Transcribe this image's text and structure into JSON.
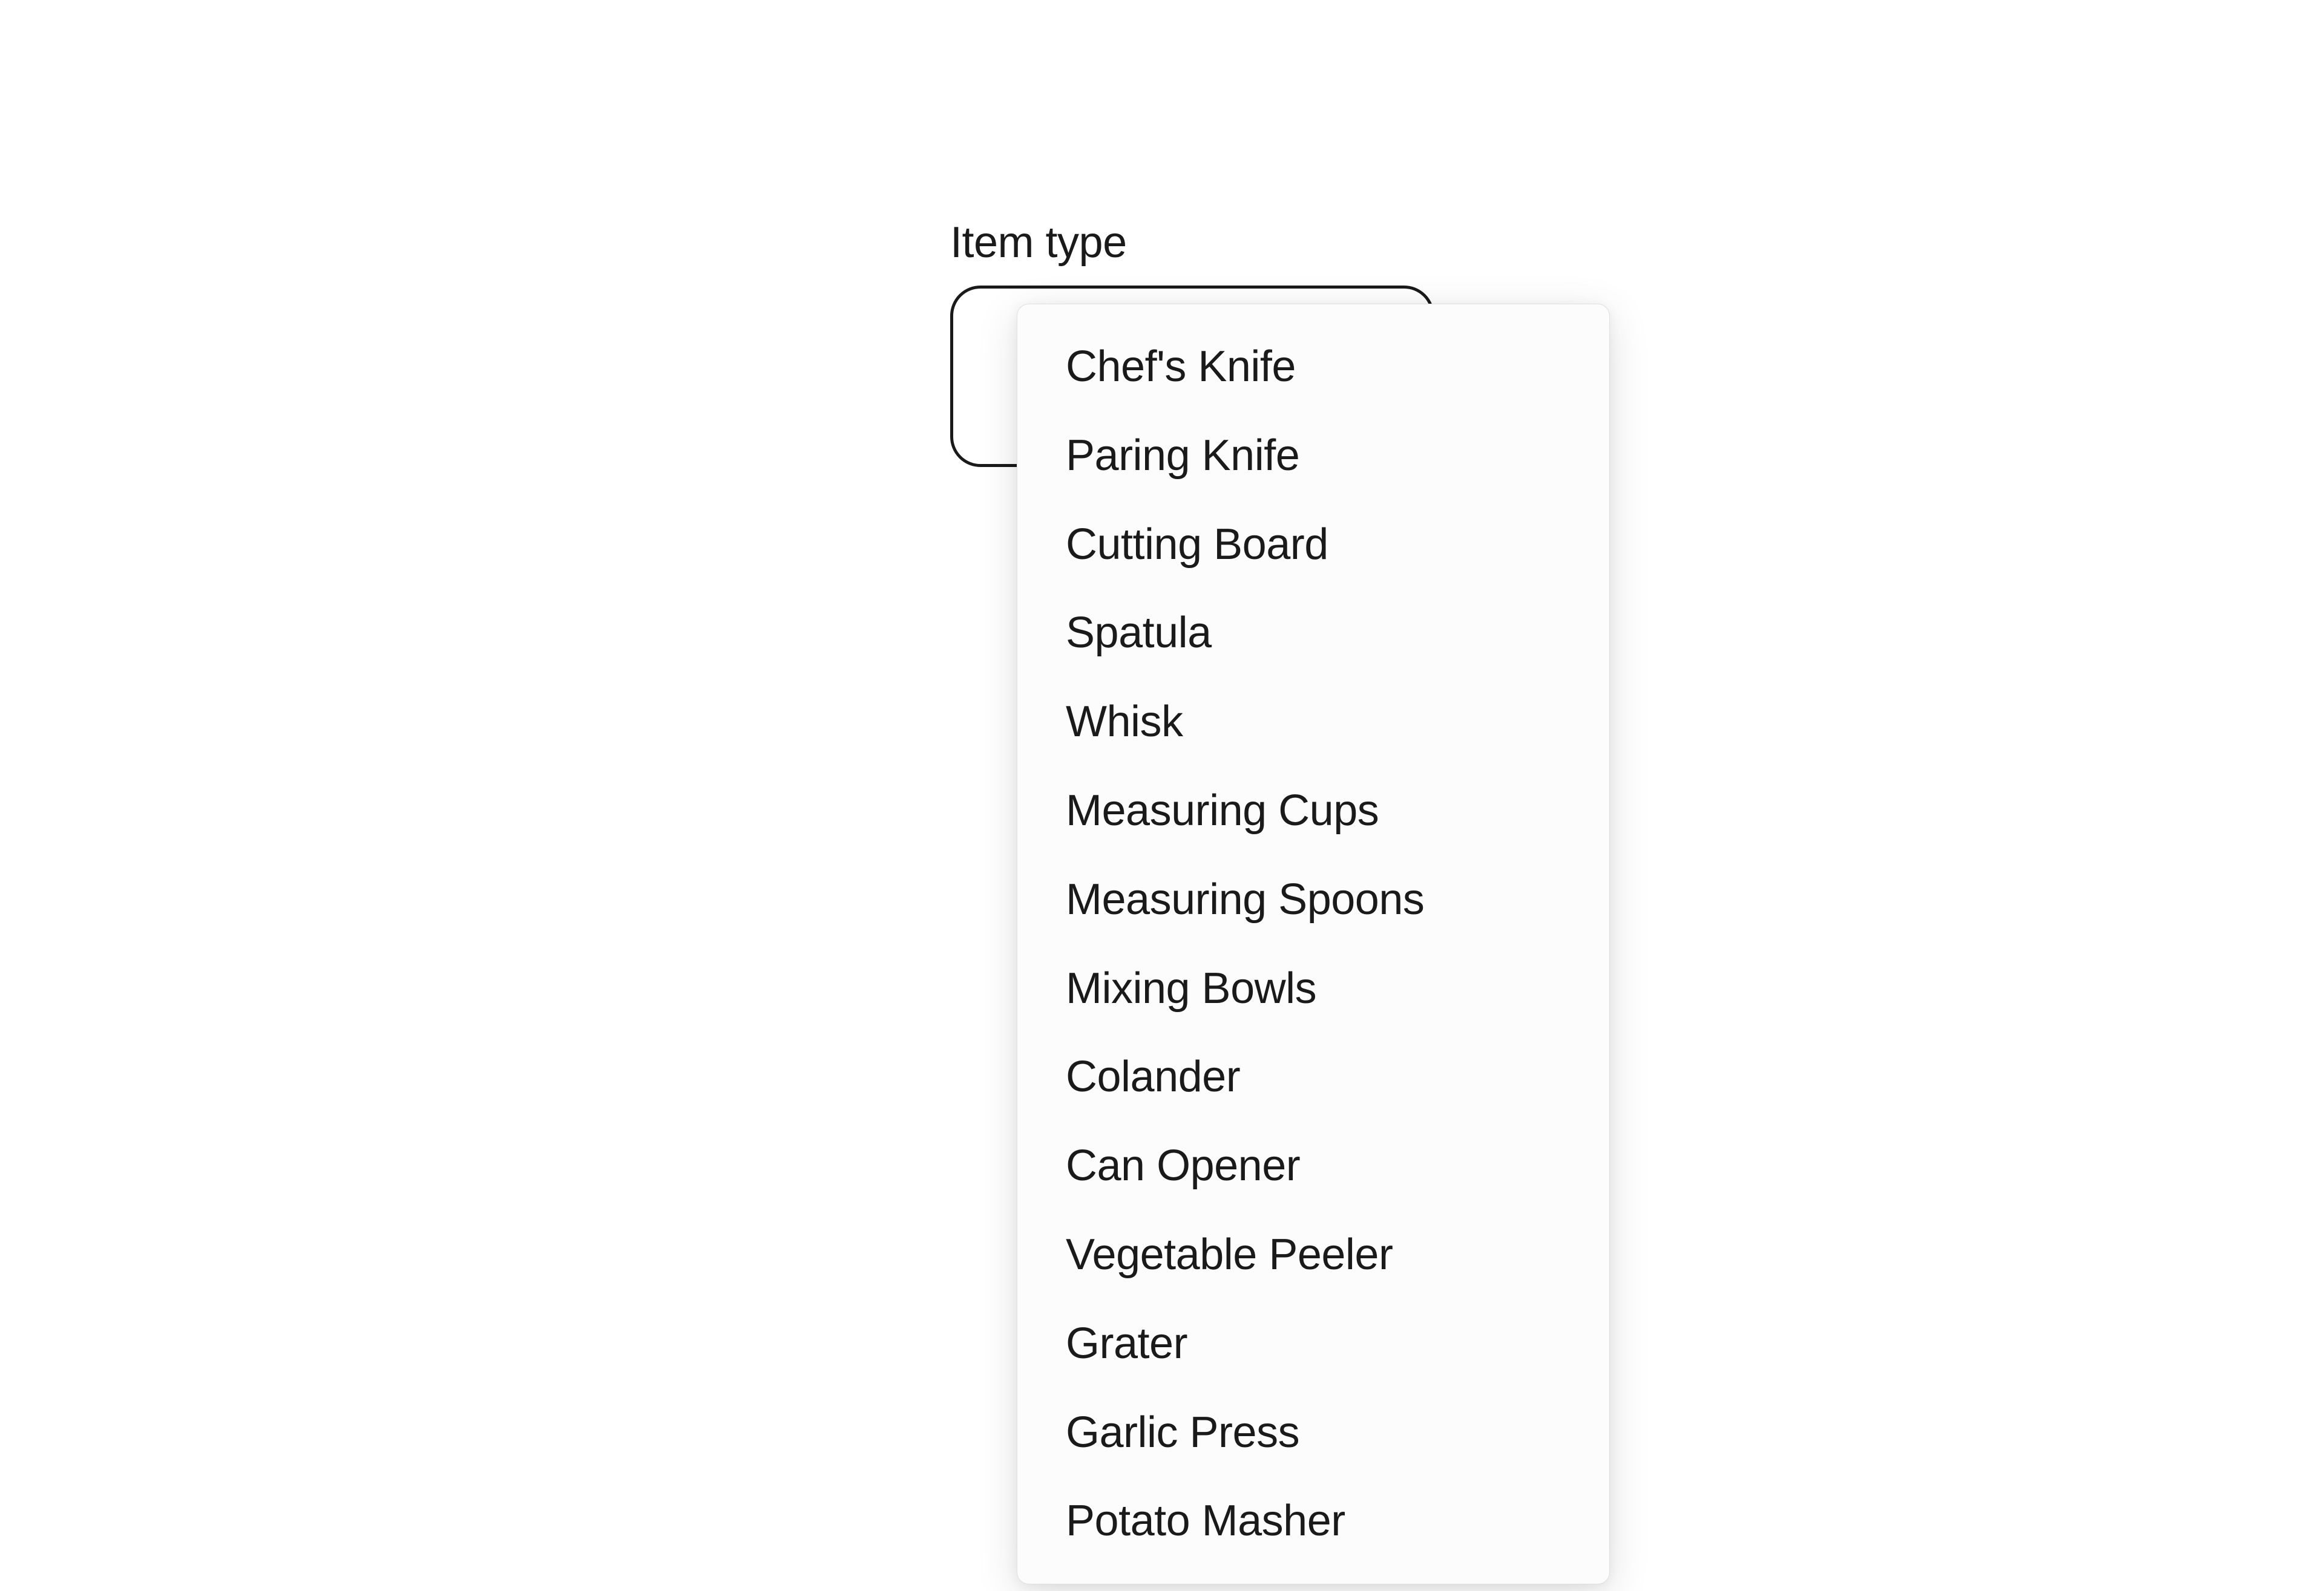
{
  "field": {
    "label": "Item type"
  },
  "dropdown": {
    "options": [
      "Chef's Knife",
      "Paring Knife",
      "Cutting Board",
      "Spatula",
      "Whisk",
      "Measuring Cups",
      "Measuring Spoons",
      "Mixing Bowls",
      "Colander",
      "Can Opener",
      "Vegetable Peeler",
      "Grater",
      "Garlic Press",
      "Potato Masher"
    ]
  }
}
